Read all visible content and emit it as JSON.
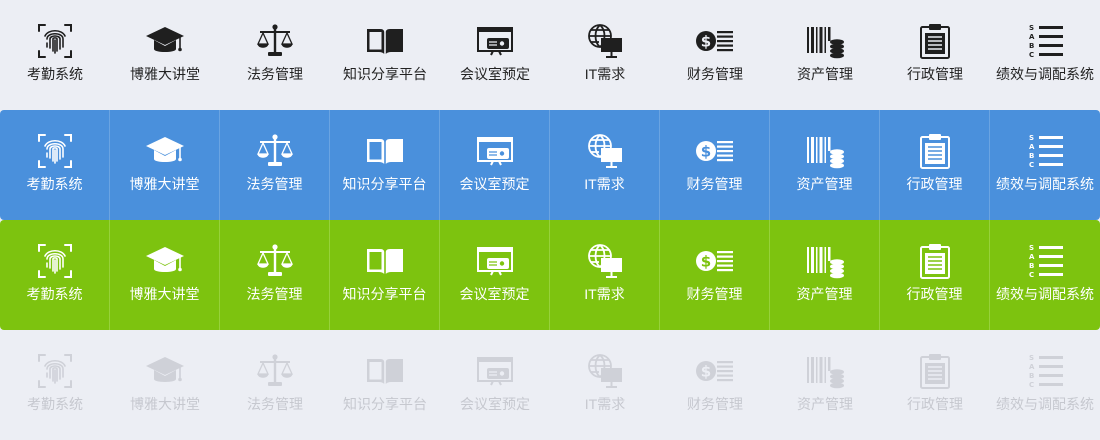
{
  "rows": [
    {
      "state": "default",
      "bg": "#eceef4",
      "text_color": "#222222"
    },
    {
      "state": "hover",
      "bg": "#4a90dc",
      "text_color": "#ffffff"
    },
    {
      "state": "active",
      "bg": "#7dc30f",
      "text_color": "#ffffff"
    },
    {
      "state": "disabled",
      "bg": "#eceef4",
      "text_color": "#c6c8cf"
    }
  ],
  "items": [
    {
      "label": "考勤系统",
      "icon": "fingerprint-icon"
    },
    {
      "label": "博雅大讲堂",
      "icon": "graduation-cap-icon"
    },
    {
      "label": "法务管理",
      "icon": "scales-icon"
    },
    {
      "label": "知识分享平台",
      "icon": "open-book-icon"
    },
    {
      "label": "会议室预定",
      "icon": "projector-icon"
    },
    {
      "label": "IT需求",
      "icon": "globe-monitor-icon"
    },
    {
      "label": "财务管理",
      "icon": "dollar-list-icon"
    },
    {
      "label": "资产管理",
      "icon": "barcode-coins-icon"
    },
    {
      "label": "行政管理",
      "icon": "clipboard-icon"
    },
    {
      "label": "绩效与调配系统",
      "icon": "sabc-list-icon"
    }
  ]
}
